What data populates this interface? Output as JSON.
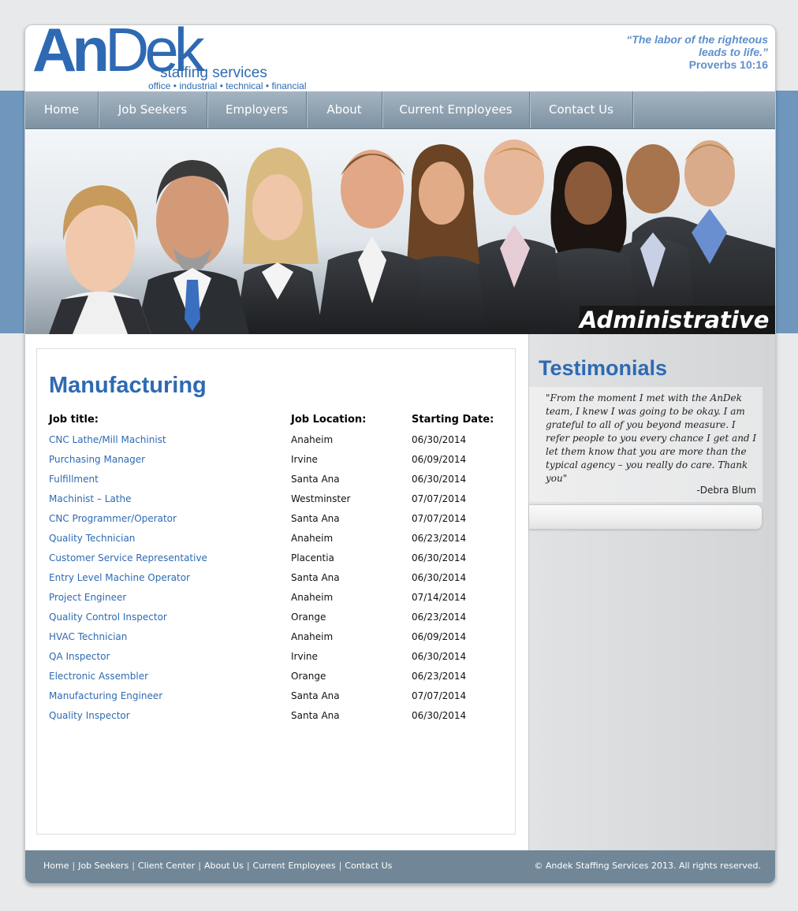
{
  "logo": {
    "name_part1": "An",
    "name_part2": "Dek",
    "tagline1": "staffing services",
    "tagline2": "office • industrial • technical • financial"
  },
  "header_quote": {
    "line1": "“The labor of the righteous",
    "line2": "leads to life.”",
    "ref": "Proverbs 10:16"
  },
  "nav": {
    "items": [
      {
        "label": "Home"
      },
      {
        "label": "Job Seekers"
      },
      {
        "label": "Employers"
      },
      {
        "label": "About"
      },
      {
        "label": "Current Employees"
      },
      {
        "label": "Contact Us"
      }
    ]
  },
  "hero": {
    "caption": "Administrative"
  },
  "main": {
    "title": "Manufacturing",
    "columns": {
      "title": "Job title:",
      "location": "Job Location:",
      "date": "Starting Date:"
    },
    "jobs": [
      {
        "title": "CNC Lathe/Mill Machinist",
        "location": "Anaheim",
        "date": "06/30/2014"
      },
      {
        "title": "Purchasing Manager",
        "location": "Irvine",
        "date": "06/09/2014"
      },
      {
        "title": "Fulfillment",
        "location": "Santa Ana",
        "date": "06/30/2014"
      },
      {
        "title": "Machinist – Lathe",
        "location": "Westminster",
        "date": "07/07/2014"
      },
      {
        "title": "CNC Programmer/Operator",
        "location": "Santa Ana",
        "date": "07/07/2014"
      },
      {
        "title": "Quality Technician",
        "location": "Anaheim",
        "date": "06/23/2014"
      },
      {
        "title": "Customer Service Representative",
        "location": "Placentia",
        "date": "06/30/2014"
      },
      {
        "title": "Entry Level Machine Operator",
        "location": "Santa Ana",
        "date": "06/30/2014"
      },
      {
        "title": "Project Engineer",
        "location": "Anaheim",
        "date": "07/14/2014"
      },
      {
        "title": "Quality Control Inspector",
        "location": "Orange",
        "date": "06/23/2014"
      },
      {
        "title": "HVAC Technician",
        "location": "Anaheim",
        "date": "06/09/2014"
      },
      {
        "title": "QA Inspector",
        "location": "Irvine",
        "date": "06/30/2014"
      },
      {
        "title": "Electronic Assembler",
        "location": "Orange",
        "date": "06/23/2014"
      },
      {
        "title": "Manufacturing Engineer",
        "location": "Santa Ana",
        "date": "07/07/2014"
      },
      {
        "title": "Quality Inspector",
        "location": "Santa Ana",
        "date": "06/30/2014"
      }
    ]
  },
  "sidebar": {
    "title": "Testimonials",
    "quote": "\"From the moment I met with the AnDek team, I knew I was going to be okay. I am grateful to all of you beyond measure. I refer people to you every chance I get and I let them know that you are more than the typical agency – you really do care. Thank you\"",
    "author": "-Debra Blum"
  },
  "footer": {
    "links": [
      {
        "label": "Home"
      },
      {
        "label": "Job Seekers"
      },
      {
        "label": "Client Center"
      },
      {
        "label": "About Us"
      },
      {
        "label": "Current Employees"
      },
      {
        "label": "Contact Us"
      }
    ],
    "copyright": "© Andek Staffing Services 2013. All rights reserved."
  },
  "colors": {
    "brand_blue": "#2e6ab3",
    "band_blue": "#6f97bd",
    "nav_gray": "#8a9dad",
    "footer_gray": "#718797"
  }
}
